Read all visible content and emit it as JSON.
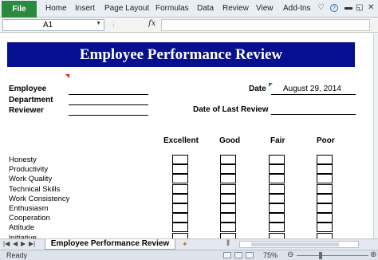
{
  "ribbon": {
    "file_label": "File",
    "tabs": [
      "Home",
      "Insert",
      "Page Layout",
      "Formulas",
      "Data",
      "Review",
      "View",
      "Add-Ins"
    ],
    "icons": [
      "heart-icon",
      "help-icon",
      "minimize-icon",
      "restore-icon",
      "close-icon"
    ]
  },
  "formula_bar": {
    "name_box": "A1",
    "fx_label": "fx",
    "formula": ""
  },
  "sheet": {
    "title": "Employee Performance Review",
    "fields": {
      "employee": "Employee",
      "department": "Department",
      "reviewer": "Reviewer",
      "date_label": "Date",
      "date_value": "August 29, 2014",
      "last_review_label": "Date of Last Review"
    },
    "ratings": [
      "Excellent",
      "Good",
      "Fair",
      "Poor"
    ],
    "criteria": [
      "Honesty",
      "Productivity",
      "Work Quality",
      "Technical Skills",
      "Work Consistency",
      "Enthusiasm",
      "Cooperation",
      "Attitude",
      "Initiative"
    ]
  },
  "sheet_tabs": {
    "active": "Employee Performance Review"
  },
  "status_bar": {
    "state": "Ready",
    "zoom": "75%"
  }
}
